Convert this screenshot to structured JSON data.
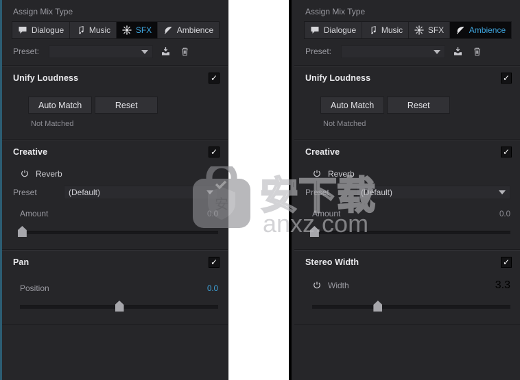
{
  "app": {
    "accent_blue": "#3fa7e0",
    "panel_bg": "#262629",
    "left_edge_accent": "#2c5d73"
  },
  "panels": [
    {
      "id": "left",
      "assign": {
        "label": "Assign Mix Type",
        "tabs": [
          {
            "label": "Dialogue",
            "icon": "speech-bubble-icon",
            "active": false
          },
          {
            "label": "Music",
            "icon": "music-note-icon",
            "active": false
          },
          {
            "label": "SFX",
            "icon": "sparkle-burst-icon",
            "active": true
          },
          {
            "label": "Ambience",
            "icon": "leaf-wind-icon",
            "active": false
          }
        ],
        "preset_label": "Preset:",
        "preset_value": "",
        "save_icon": "save-preset-icon",
        "delete_icon": "trash-icon"
      },
      "sections": [
        {
          "kind": "loudness",
          "title": "Unify Loudness",
          "checked": "✓",
          "buttons": [
            "Auto Match",
            "Reset"
          ],
          "status": "Not Matched"
        },
        {
          "kind": "creative",
          "title": "Creative",
          "checked": "✓",
          "power_label": "Reverb",
          "preset_label": "Preset",
          "preset_value": "(Default)",
          "slider_label": "Amount",
          "slider_value": "0.0",
          "slider_pct": 1,
          "accent_value": false
        },
        {
          "kind": "simple-slider",
          "title": "Pan",
          "checked": "✓",
          "power": false,
          "slider_label": "Position",
          "slider_value": "0.0",
          "slider_pct": 50,
          "accent_value": true
        }
      ]
    },
    {
      "id": "right",
      "assign": {
        "label": "Assign Mix Type",
        "tabs": [
          {
            "label": "Dialogue",
            "icon": "speech-bubble-icon",
            "active": false
          },
          {
            "label": "Music",
            "icon": "music-note-icon",
            "active": false
          },
          {
            "label": "SFX",
            "icon": "sparkle-burst-icon",
            "active": false
          },
          {
            "label": "Ambience",
            "icon": "leaf-wind-icon",
            "active": true
          }
        ],
        "preset_label": "Preset:",
        "preset_value": "",
        "save_icon": "save-preset-icon",
        "delete_icon": "trash-icon"
      },
      "sections": [
        {
          "kind": "loudness",
          "title": "Unify Loudness",
          "checked": "✓",
          "buttons": [
            "Auto Match",
            "Reset"
          ],
          "status": "Not Matched"
        },
        {
          "kind": "creative",
          "title": "Creative",
          "checked": "✓",
          "power_label": "Reverb",
          "preset_label": "Preset",
          "preset_value": "(Default)",
          "slider_label": "Amount",
          "slider_value": "0.0",
          "slider_pct": 1,
          "accent_value": false
        },
        {
          "kind": "simple-slider",
          "title": "Stereo Width",
          "checked": "✓",
          "power": true,
          "slider_label": "Width",
          "slider_value": "3.3",
          "slider_pct": 33,
          "accent_value": false
        }
      ]
    }
  ],
  "watermark": {
    "cn_text": "安下载",
    "domain_text": "anxz.com"
  }
}
